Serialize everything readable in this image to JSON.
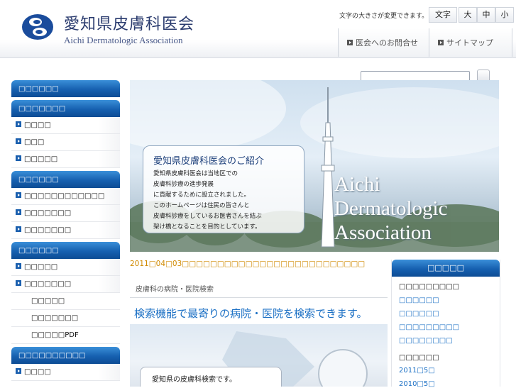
{
  "header": {
    "logo_title": "愛知県皮膚科医会",
    "logo_subtitle": "Aichi Dermatologic Association",
    "font_size_label": "文字の大きさが変更できます。",
    "font_size_buttons": {
      "moji": "文字",
      "large": "大",
      "medium": "中",
      "small": "小"
    },
    "links": {
      "contact": "医会へのお問合せ",
      "sitemap": "サイトマップ"
    }
  },
  "sidebar": {
    "sections": [
      {
        "title": "□□□□□□",
        "items": []
      },
      {
        "title": "□□□□□□□",
        "items": [
          "□□□□",
          "□□□",
          "□□□□□"
        ]
      },
      {
        "title": "□□□□□□",
        "items": [
          "□□□□□□□□□□□□",
          "□□□□□□□",
          "□□□□□□□"
        ]
      },
      {
        "title": "□□□□□□",
        "items": [
          "□□□□□",
          "□□□□□□□"
        ],
        "subitems": [
          "□□□□□",
          "□□□□□□□",
          "□□□□□PDF"
        ]
      },
      {
        "title": "□□□□□□□□□□",
        "items": [
          "□□□□"
        ]
      }
    ]
  },
  "banner": {
    "intro_title": "愛知県皮膚科医会のご紹介",
    "intro_lines": [
      "愛知県皮膚科医会は当地区での",
      "皮膚科診療の進歩発展",
      "に貢献するために設立されました。",
      "このホームページは住民の皆さんと",
      "皮膚科診療をしているお医者さんを結ぶ",
      "架け橋となることを目的としています。"
    ],
    "title_lines": [
      "Aichi",
      "Dermatologic",
      "Association"
    ]
  },
  "news": "2011□04□03□□□□□□□□□□□□□□□□□□□□□□□□□□",
  "search_section": {
    "label": "皮膚科の病院・医院検索",
    "headline": "検索機能で最寄りの病院・医院を検索できます。",
    "image_caption": "愛知県の皮膚科検索です。"
  },
  "right_box": {
    "title": "□□□□□",
    "category1": "□□□□□□□□□",
    "links": [
      "□□□□□□",
      "□□□□□□",
      "□□□□□□□□□",
      "□□□□□□□□"
    ],
    "category2": "□□□□□□",
    "archives": [
      "2011□5□",
      "2010□5□"
    ]
  },
  "colors": {
    "accent_blue": "#1660b0",
    "link_blue": "#1a6fc4",
    "news_orange": "#d08a00"
  }
}
